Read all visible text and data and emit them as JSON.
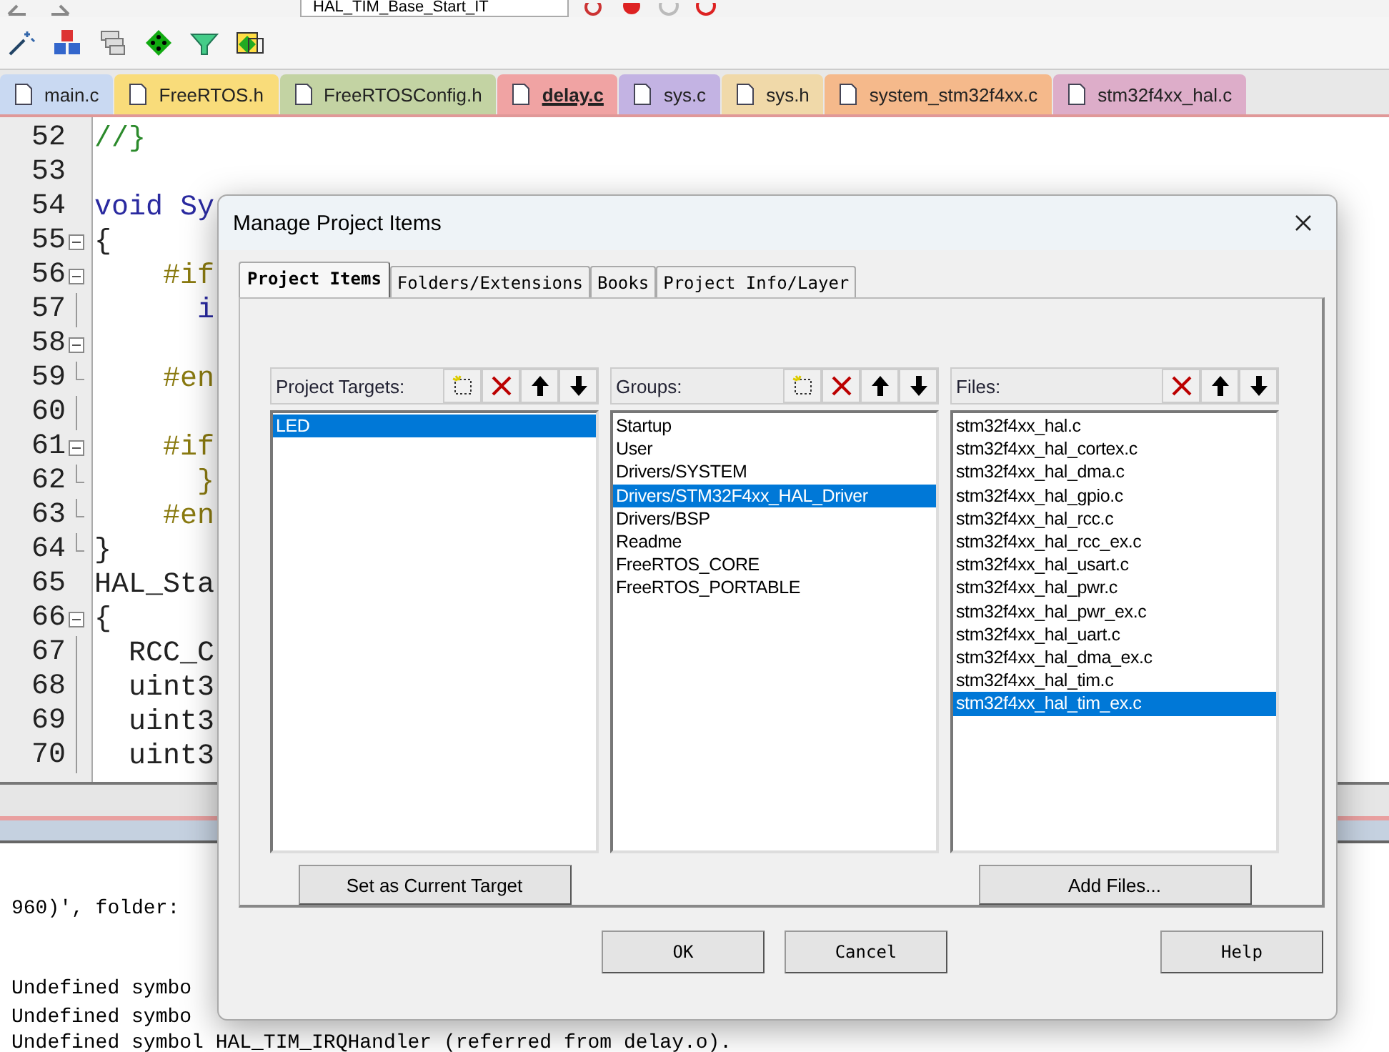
{
  "toolbar": {
    "function_combo": "HAL_TIM_Base_Start_IT"
  },
  "file_tabs": [
    {
      "label": "main.c",
      "color": "#c9d9f2",
      "selected": false
    },
    {
      "label": "FreeRTOS.h",
      "color": "#f9dc7a",
      "selected": false
    },
    {
      "label": "FreeRTOSConfig.h",
      "color": "#c3d3a3",
      "selected": false
    },
    {
      "label": "delay.c",
      "color": "#f0a3a3",
      "selected": true
    },
    {
      "label": "sys.c",
      "color": "#c3b3e3",
      "selected": false
    },
    {
      "label": "sys.h",
      "color": "#f0d9a9",
      "selected": false
    },
    {
      "label": "system_stm32f4xx.c",
      "color": "#f5b98b",
      "selected": false
    },
    {
      "label": "stm32f4xx_hal.c",
      "color": "#ddadc9",
      "selected": false
    }
  ],
  "editor": {
    "lines": [
      {
        "number": "52",
        "kind": "plain",
        "code": "//}",
        "color": "#2b8a2b"
      },
      {
        "number": "53",
        "kind": "plain"
      },
      {
        "number": "54",
        "kind": "plain",
        "code": "void Sy",
        "color": "#2a2aa0"
      },
      {
        "number": "55",
        "kind": "fold",
        "code": "{",
        "color": "#222222"
      },
      {
        "number": "56",
        "kind": "fold",
        "code": "    #if",
        "color": "#8a7a10"
      },
      {
        "number": "57",
        "kind": "branch",
        "code": "      i",
        "color": "#2a2aa0"
      },
      {
        "number": "58",
        "kind": "fold"
      },
      {
        "number": "59",
        "kind": "end",
        "code": "    #en",
        "color": "#8a7a10"
      },
      {
        "number": "60",
        "kind": "branch"
      },
      {
        "number": "61",
        "kind": "fold",
        "code": "    #if",
        "color": "#8a7a10"
      },
      {
        "number": "62",
        "kind": "end",
        "code": "      }",
        "color": "#8a7a10"
      },
      {
        "number": "63",
        "kind": "end",
        "code": "    #en",
        "color": "#8a7a10"
      },
      {
        "number": "64",
        "kind": "end",
        "code": "}",
        "color": "#222222"
      },
      {
        "number": "65",
        "kind": "plain",
        "code": "HAL_Sta",
        "color": "#222222"
      },
      {
        "number": "66",
        "kind": "fold",
        "code": "{",
        "color": "#222222"
      },
      {
        "number": "67",
        "kind": "branch",
        "code": "  RCC_C",
        "color": "#222222"
      },
      {
        "number": "68",
        "kind": "branch",
        "code": "  uint3",
        "color": "#222222"
      },
      {
        "number": "69",
        "kind": "branch",
        "code": "  uint3",
        "color": "#222222"
      },
      {
        "number": "70",
        "kind": "branch",
        "code": "  uint3",
        "color": "#222222"
      }
    ]
  },
  "output": {
    "lines": [
      "960)', folder:",
      "Undefined symbo",
      "Undefined symbo",
      "Undefined symbol HAL_TIM_IRQHandler (referred from delay.o)."
    ]
  },
  "dialog": {
    "title": "Manage Project Items",
    "tabs": [
      {
        "label": "Project Items",
        "selected": true
      },
      {
        "label": "Folders/Extensions",
        "selected": false
      },
      {
        "label": "Books",
        "selected": false
      },
      {
        "label": "Project Info/Layer",
        "selected": false
      }
    ],
    "panels": [
      {
        "label": "Project Targets:",
        "can_add": true,
        "items": [
          {
            "label": "LED",
            "selected": true
          }
        ],
        "button": "Set as Current Target"
      },
      {
        "label": "Groups:",
        "can_add": true,
        "items": [
          {
            "label": "Startup",
            "selected": false
          },
          {
            "label": "User",
            "selected": false
          },
          {
            "label": "Drivers/SYSTEM",
            "selected": false
          },
          {
            "label": "Drivers/STM32F4xx_HAL_Driver",
            "selected": true
          },
          {
            "label": "Drivers/BSP",
            "selected": false
          },
          {
            "label": "Readme",
            "selected": false
          },
          {
            "label": "FreeRTOS_CORE",
            "selected": false
          },
          {
            "label": "FreeRTOS_PORTABLE",
            "selected": false
          }
        ]
      },
      {
        "label": "Files:",
        "can_add": false,
        "items": [
          {
            "label": "stm32f4xx_hal.c",
            "selected": false
          },
          {
            "label": "stm32f4xx_hal_cortex.c",
            "selected": false
          },
          {
            "label": "stm32f4xx_hal_dma.c",
            "selected": false
          },
          {
            "label": "stm32f4xx_hal_gpio.c",
            "selected": false
          },
          {
            "label": "stm32f4xx_hal_rcc.c",
            "selected": false
          },
          {
            "label": "stm32f4xx_hal_rcc_ex.c",
            "selected": false
          },
          {
            "label": "stm32f4xx_hal_usart.c",
            "selected": false
          },
          {
            "label": "stm32f4xx_hal_pwr.c",
            "selected": false
          },
          {
            "label": "stm32f4xx_hal_pwr_ex.c",
            "selected": false
          },
          {
            "label": "stm32f4xx_hal_uart.c",
            "selected": false
          },
          {
            "label": "stm32f4xx_hal_dma_ex.c",
            "selected": false
          },
          {
            "label": "stm32f4xx_hal_tim.c",
            "selected": false
          },
          {
            "label": "stm32f4xx_hal_tim_ex.c",
            "selected": true
          }
        ],
        "button": "Add Files..."
      }
    ],
    "buttons": [
      "OK",
      "Cancel",
      "Help"
    ]
  }
}
